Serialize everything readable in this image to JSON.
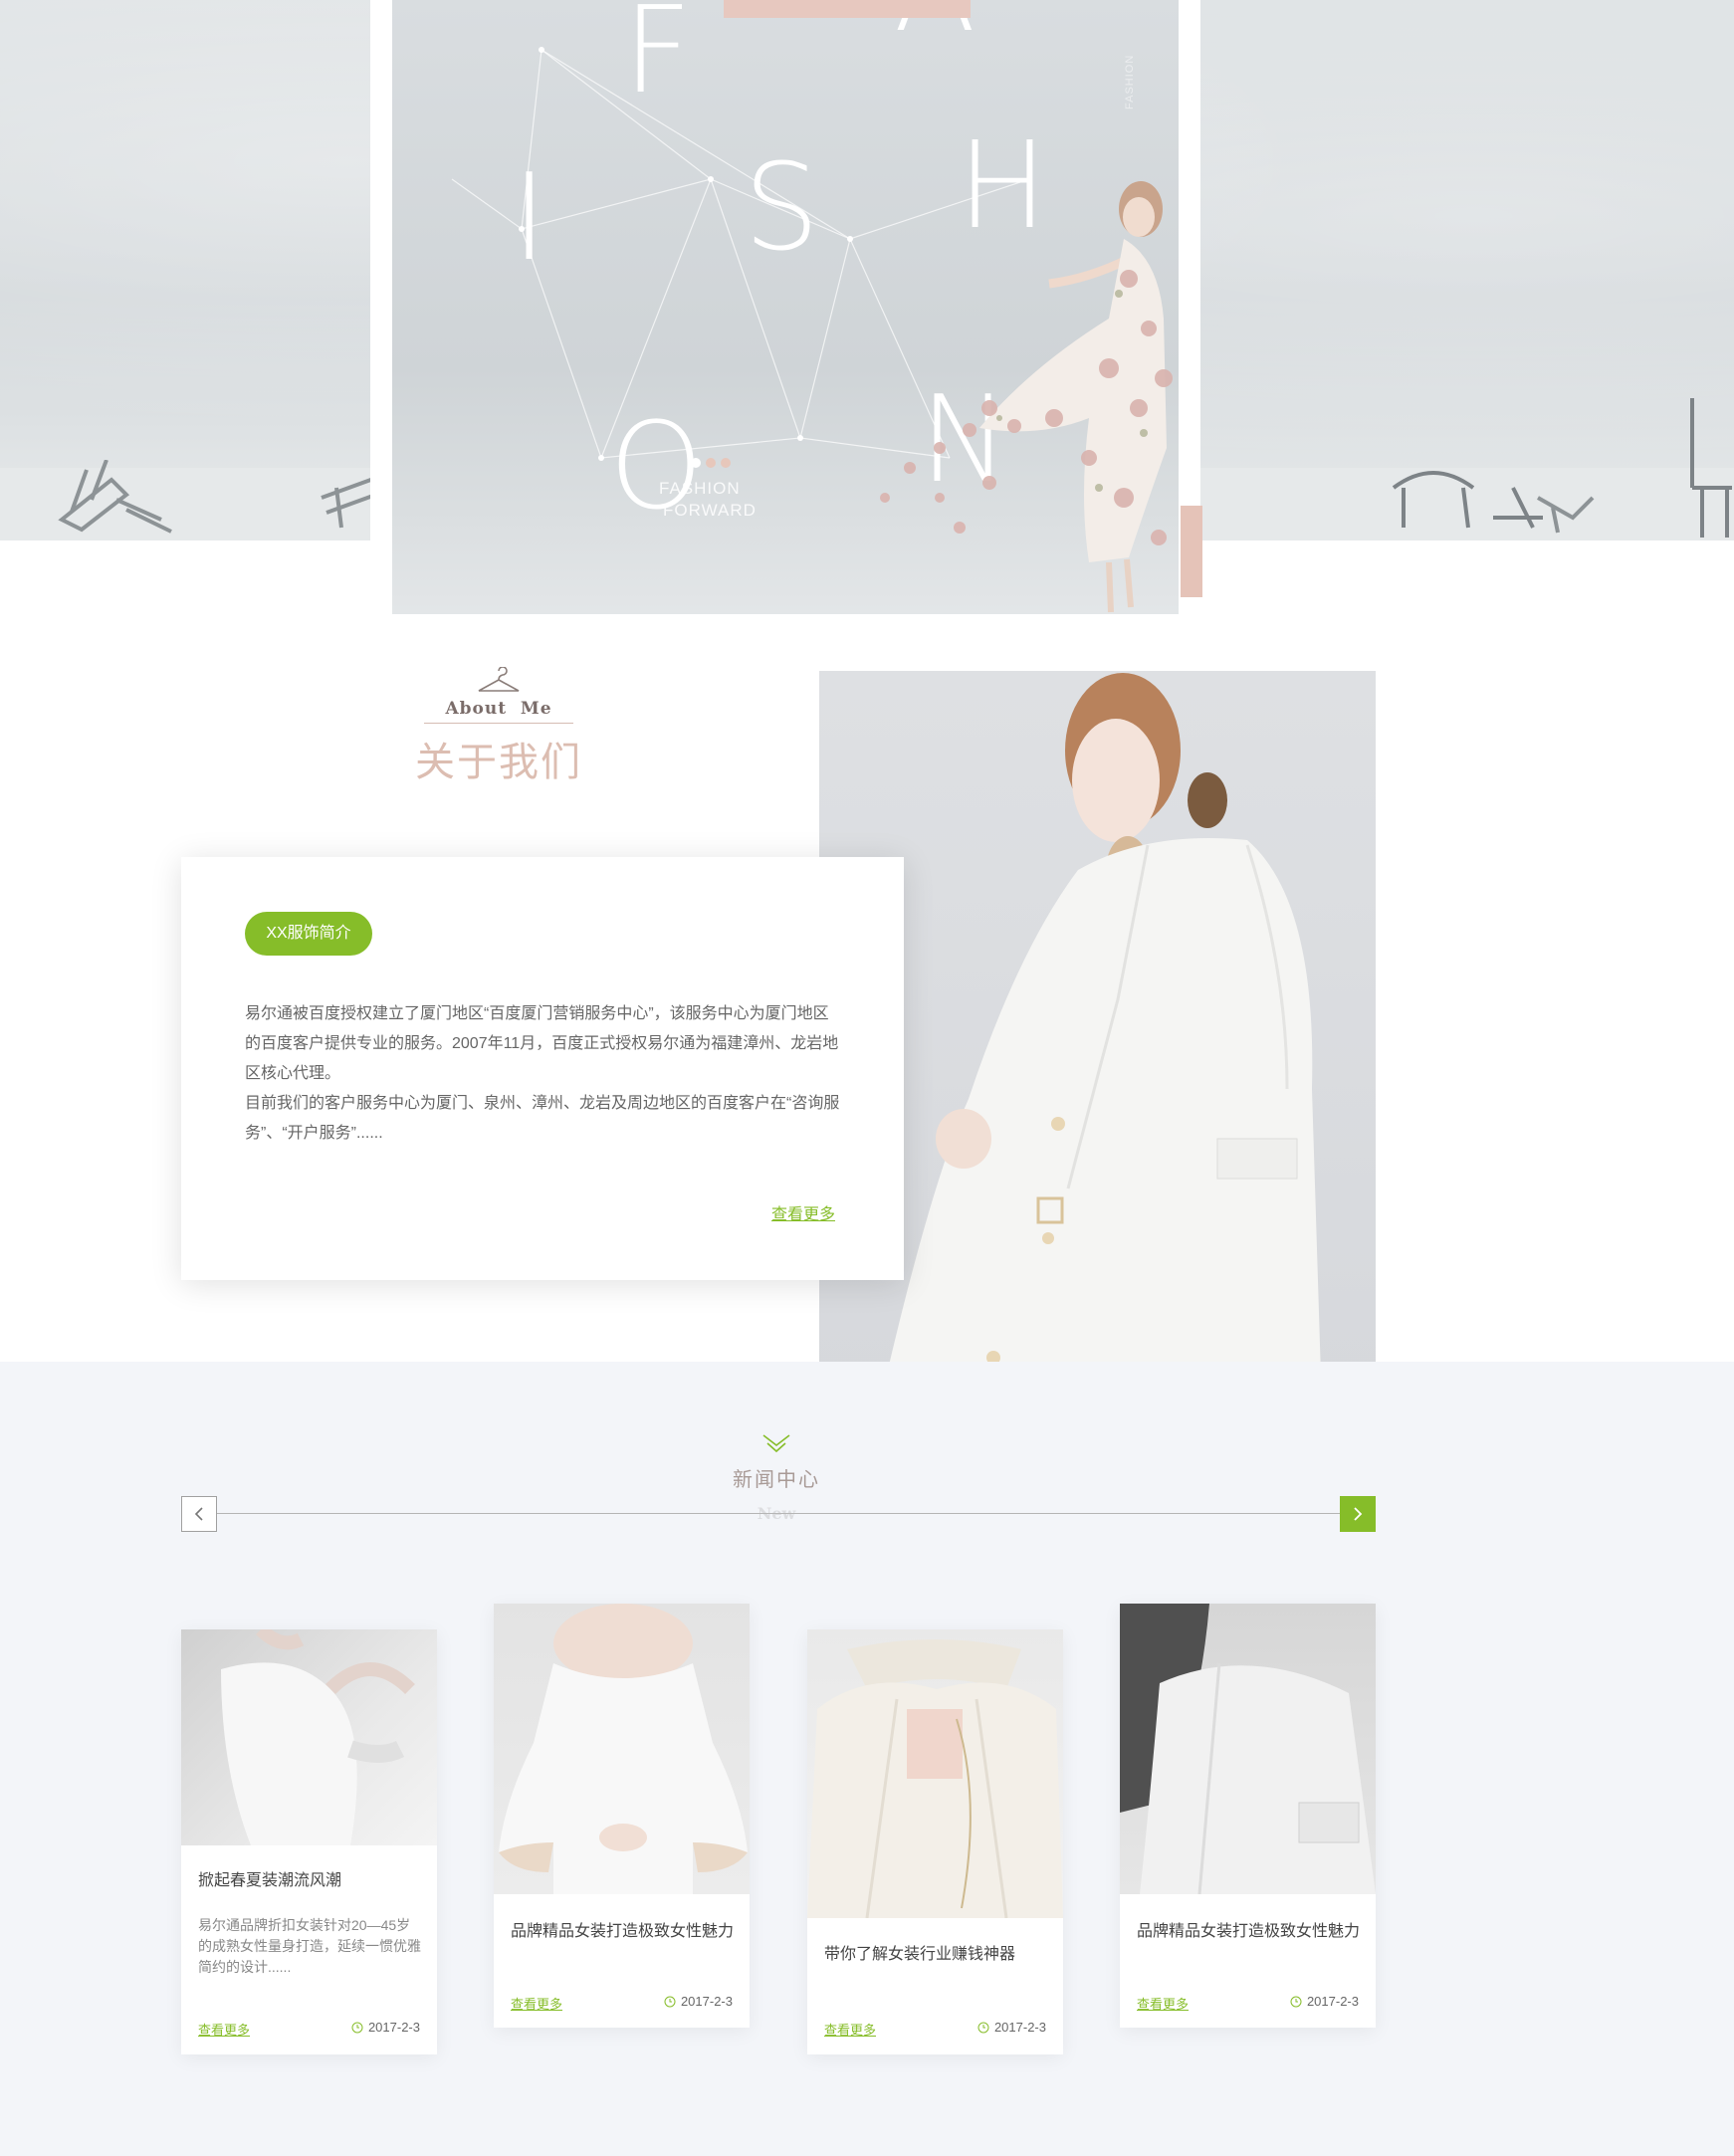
{
  "hero": {
    "letters": [
      "F",
      "A",
      "I",
      "S",
      "H",
      "O",
      "N"
    ],
    "subtitle_line1": "FASHION",
    "subtitle_line2": "FORWARD",
    "vertical_text": "FASHION",
    "slides": 3,
    "active_slide": 1,
    "accent_pink": "#e7c8bf"
  },
  "about": {
    "en_title": "About  Me",
    "cn_title": "关于我们",
    "badge": "XX服饰简介",
    "paragraph1": "易尔通被百度授权建立了厦门地区“百度厦门营销服务中心”，该服务中心为厦门地区的百度客户提供专业的服务。2007年11月，百度正式授权易尔通为福建漳州、龙岩地区核心代理。",
    "paragraph2": "目前我们的客户服务中心为厦门、泉州、漳州、龙岩及周边地区的百度客户在“咨询服务”、“开户服务”......",
    "more": "查看更多",
    "accent_green": "#86bd29"
  },
  "news": {
    "cn_title": "新闻中心",
    "en_title": "New",
    "prev_icon": "chevron-left-icon",
    "next_icon": "chevron-right-icon",
    "cards": [
      {
        "title": "掀起春夏装潮流风潮",
        "desc": "易尔通品牌折扣女装针对20—45岁的成熟女性量身打造，延续一惯优雅简约的设计......",
        "more": "查看更多",
        "date": "2017-2-3"
      },
      {
        "title": "品牌精品女装打造极致女性魅力",
        "more": "查看更多",
        "date": "2017-2-3"
      },
      {
        "title": "带你了解女装行业赚钱神器",
        "more": "查看更多",
        "date": "2017-2-3"
      },
      {
        "title": "品牌精品女装打造极致女性魅力",
        "more": "查看更多",
        "date": "2017-2-3"
      }
    ]
  }
}
